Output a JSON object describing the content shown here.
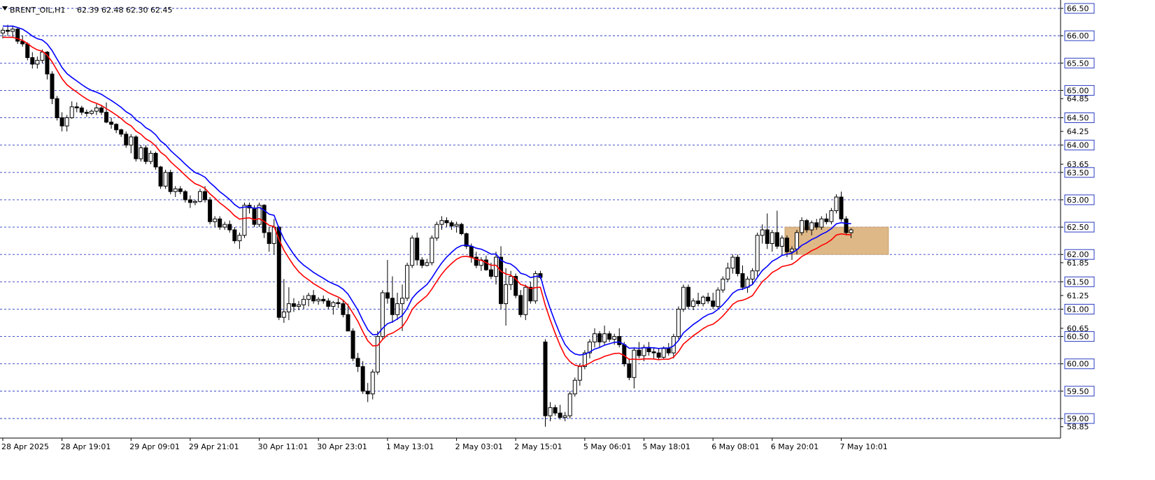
{
  "header": {
    "symbol": "BRENT_OIL,H1",
    "ohlc": "62.39 62.48 62.30 62.45"
  },
  "colors": {
    "grid": "#2a3cc2",
    "ma_fast": "#0000ff",
    "ma_slow": "#ff0000",
    "zone": "#deb887",
    "candle": "#000000",
    "background": "#ffffff"
  },
  "chart_data": {
    "type": "candlestick",
    "symbol": "BRENT_OIL",
    "timeframe": "H1",
    "ylim": [
      58.7,
      66.6
    ],
    "grid": true,
    "y_levels": [
      {
        "value": 66.5,
        "label": "66.50",
        "badge": true
      },
      {
        "value": 66.0,
        "label": "66.00",
        "badge": true
      },
      {
        "value": 65.5,
        "label": "65.50",
        "badge": true
      },
      {
        "value": 65.0,
        "label": "65.00",
        "badge": true
      },
      {
        "value": 64.85,
        "label": "64.85",
        "badge": false
      },
      {
        "value": 64.5,
        "label": "64.50",
        "badge": true
      },
      {
        "value": 64.25,
        "label": "64.25",
        "badge": false
      },
      {
        "value": 64.0,
        "label": "64.00",
        "badge": true
      },
      {
        "value": 63.65,
        "label": "63.65",
        "badge": false
      },
      {
        "value": 63.5,
        "label": "63.50",
        "badge": true
      },
      {
        "value": 63.0,
        "label": "63.00",
        "badge": true
      },
      {
        "value": 62.5,
        "label": "62.50",
        "badge": true
      },
      {
        "value": 62.0,
        "label": "62.00",
        "badge": true
      },
      {
        "value": 61.85,
        "label": "61.85",
        "badge": false
      },
      {
        "value": 61.5,
        "label": "61.50",
        "badge": true
      },
      {
        "value": 61.25,
        "label": "61.25",
        "badge": false
      },
      {
        "value": 61.0,
        "label": "61.00",
        "badge": true
      },
      {
        "value": 60.65,
        "label": "60.65",
        "badge": false
      },
      {
        "value": 60.5,
        "label": "60.50",
        "badge": true
      },
      {
        "value": 60.0,
        "label": "60.00",
        "badge": true
      },
      {
        "value": 59.5,
        "label": "59.50",
        "badge": true
      },
      {
        "value": 59.0,
        "label": "59.00",
        "badge": true
      },
      {
        "value": 58.85,
        "label": "58.85",
        "badge": false
      }
    ],
    "x_labels": [
      {
        "bar": 0,
        "label": "28 Apr 2025"
      },
      {
        "bar": 12,
        "label": "28 Apr 19:01"
      },
      {
        "bar": 26,
        "label": "29 Apr 09:01"
      },
      {
        "bar": 38,
        "label": "29 Apr 21:01"
      },
      {
        "bar": 52,
        "label": "30 Apr 11:01"
      },
      {
        "bar": 64,
        "label": "30 Apr 23:01"
      },
      {
        "bar": 78,
        "label": "1 May 13:01"
      },
      {
        "bar": 92,
        "label": "2 May 03:01"
      },
      {
        "bar": 104,
        "label": "2 May 15:01"
      },
      {
        "bar": 118,
        "label": "5 May 06:01"
      },
      {
        "bar": 130,
        "label": "5 May 18:01"
      },
      {
        "bar": 144,
        "label": "6 May 08:01"
      },
      {
        "bar": 156,
        "label": "6 May 20:01"
      },
      {
        "bar": 170,
        "label": "7 May 10:01"
      }
    ],
    "supply_zone": {
      "y_low": 62.0,
      "y_high": 62.5,
      "start_bar": 159
    },
    "ohlc": [
      [
        66.05,
        66.15,
        65.95,
        66.1
      ],
      [
        66.1,
        66.2,
        66.0,
        66.08
      ],
      [
        66.08,
        66.18,
        65.98,
        66.12
      ],
      [
        66.12,
        66.15,
        65.85,
        65.9
      ],
      [
        65.9,
        66.0,
        65.8,
        65.85
      ],
      [
        65.85,
        65.88,
        65.55,
        65.6
      ],
      [
        65.6,
        65.7,
        65.4,
        65.48
      ],
      [
        65.48,
        65.62,
        65.4,
        65.55
      ],
      [
        65.55,
        65.75,
        65.5,
        65.7
      ],
      [
        65.7,
        65.72,
        65.2,
        65.3
      ],
      [
        65.3,
        65.35,
        64.75,
        64.85
      ],
      [
        64.85,
        64.9,
        64.45,
        64.5
      ],
      [
        64.5,
        64.6,
        64.25,
        64.35
      ],
      [
        64.35,
        64.55,
        64.25,
        64.5
      ],
      [
        64.5,
        64.8,
        64.48,
        64.7
      ],
      [
        64.7,
        64.78,
        64.6,
        64.68
      ],
      [
        64.68,
        64.72,
        64.55,
        64.6
      ],
      [
        64.6,
        64.65,
        64.52,
        64.58
      ],
      [
        64.58,
        64.65,
        64.55,
        64.62
      ],
      [
        64.62,
        64.75,
        64.55,
        64.68
      ],
      [
        64.68,
        64.72,
        64.55,
        64.6
      ],
      [
        64.6,
        64.78,
        64.4,
        64.42
      ],
      [
        64.42,
        64.5,
        64.3,
        64.38
      ],
      [
        64.38,
        64.4,
        64.22,
        64.28
      ],
      [
        64.28,
        64.3,
        64.15,
        64.2
      ],
      [
        64.2,
        64.25,
        63.95,
        64.0
      ],
      [
        64.0,
        64.2,
        63.85,
        64.15
      ],
      [
        64.15,
        64.18,
        63.7,
        63.75
      ],
      [
        63.75,
        64.0,
        63.7,
        63.95
      ],
      [
        63.95,
        64.0,
        63.65,
        63.7
      ],
      [
        63.7,
        63.9,
        63.65,
        63.85
      ],
      [
        63.85,
        63.88,
        63.55,
        63.6
      ],
      [
        63.6,
        63.62,
        63.2,
        63.25
      ],
      [
        63.25,
        63.55,
        63.2,
        63.5
      ],
      [
        63.5,
        63.55,
        63.1,
        63.15
      ],
      [
        63.15,
        63.25,
        63.05,
        63.2
      ],
      [
        63.2,
        63.25,
        63.1,
        63.15
      ],
      [
        63.15,
        63.18,
        62.95,
        63.0
      ],
      [
        63.0,
        63.08,
        62.85,
        62.95
      ],
      [
        62.95,
        63.0,
        62.9,
        62.97
      ],
      [
        62.97,
        63.2,
        62.95,
        63.15
      ],
      [
        63.15,
        63.25,
        62.95,
        63.0
      ],
      [
        63.0,
        63.05,
        62.55,
        62.6
      ],
      [
        62.6,
        62.7,
        62.5,
        62.65
      ],
      [
        62.65,
        62.7,
        62.45,
        62.5
      ],
      [
        62.5,
        62.6,
        62.45,
        62.55
      ],
      [
        62.55,
        62.62,
        62.4,
        62.45
      ],
      [
        62.45,
        62.5,
        62.2,
        62.25
      ],
      [
        62.25,
        62.4,
        62.1,
        62.35
      ],
      [
        62.35,
        62.95,
        62.3,
        62.9
      ],
      [
        62.9,
        62.95,
        62.75,
        62.85
      ],
      [
        62.85,
        62.9,
        62.5,
        62.55
      ],
      [
        62.55,
        62.95,
        62.5,
        62.9
      ],
      [
        62.9,
        62.92,
        62.3,
        62.4
      ],
      [
        62.4,
        62.5,
        62.05,
        62.2
      ],
      [
        62.2,
        62.65,
        62.0,
        62.5
      ],
      [
        62.5,
        62.52,
        60.8,
        60.85
      ],
      [
        60.85,
        61.55,
        60.75,
        60.95
      ],
      [
        60.95,
        61.4,
        60.8,
        61.1
      ],
      [
        61.1,
        61.2,
        60.95,
        61.05
      ],
      [
        61.05,
        61.15,
        60.98,
        61.08
      ],
      [
        61.08,
        61.25,
        61.0,
        61.18
      ],
      [
        61.18,
        61.3,
        61.05,
        61.25
      ],
      [
        61.25,
        61.35,
        61.1,
        61.15
      ],
      [
        61.15,
        61.22,
        61.08,
        61.18
      ],
      [
        61.18,
        61.25,
        61.1,
        61.15
      ],
      [
        61.15,
        61.2,
        61.0,
        61.05
      ],
      [
        61.05,
        61.15,
        60.9,
        61.12
      ],
      [
        61.12,
        61.2,
        61.02,
        61.1
      ],
      [
        61.1,
        61.15,
        60.85,
        60.9
      ],
      [
        60.9,
        61.1,
        60.6,
        60.6
      ],
      [
        60.6,
        60.65,
        60.05,
        60.1
      ],
      [
        60.1,
        60.2,
        59.85,
        59.95
      ],
      [
        59.95,
        60.05,
        59.45,
        59.5
      ],
      [
        59.5,
        59.65,
        59.3,
        59.45
      ],
      [
        59.45,
        59.9,
        59.35,
        59.85
      ],
      [
        59.85,
        60.6,
        59.8,
        60.5
      ],
      [
        60.5,
        61.35,
        60.45,
        61.3
      ],
      [
        61.3,
        61.9,
        61.1,
        61.2
      ],
      [
        61.2,
        61.6,
        60.75,
        60.9
      ],
      [
        60.9,
        61.3,
        60.8,
        61.1
      ],
      [
        61.1,
        61.45,
        60.6,
        61.2
      ],
      [
        61.2,
        61.85,
        61.15,
        61.8
      ],
      [
        61.8,
        62.35,
        61.75,
        62.3
      ],
      [
        62.3,
        62.4,
        61.8,
        61.9
      ],
      [
        61.9,
        61.95,
        61.75,
        61.8
      ],
      [
        61.8,
        61.92,
        61.78,
        61.85
      ],
      [
        61.85,
        62.35,
        61.8,
        62.3
      ],
      [
        62.3,
        62.6,
        62.25,
        62.55
      ],
      [
        62.55,
        62.7,
        62.45,
        62.62
      ],
      [
        62.62,
        62.68,
        62.5,
        62.58
      ],
      [
        62.58,
        62.62,
        62.45,
        62.52
      ],
      [
        62.52,
        62.6,
        62.4,
        62.55
      ],
      [
        62.55,
        62.58,
        62.35,
        62.38
      ],
      [
        62.38,
        62.4,
        62.1,
        62.15
      ],
      [
        62.15,
        62.2,
        61.85,
        61.95
      ],
      [
        61.95,
        62.05,
        61.75,
        61.8
      ],
      [
        61.8,
        61.95,
        61.7,
        61.9
      ],
      [
        61.9,
        61.98,
        61.7,
        61.72
      ],
      [
        61.72,
        61.85,
        61.55,
        61.6
      ],
      [
        61.6,
        62.05,
        61.45,
        61.95
      ],
      [
        61.95,
        62.15,
        61.0,
        61.1
      ],
      [
        61.1,
        61.75,
        60.7,
        61.45
      ],
      [
        61.45,
        61.7,
        61.35,
        61.6
      ],
      [
        61.6,
        61.65,
        61.2,
        61.25
      ],
      [
        61.25,
        61.35,
        60.85,
        60.9
      ],
      [
        60.9,
        61.45,
        60.8,
        61.4
      ],
      [
        61.4,
        61.5,
        61.1,
        61.15
      ],
      [
        61.15,
        61.7,
        61.1,
        61.65
      ],
      [
        61.65,
        61.7,
        61.55,
        61.58
      ],
      [
        60.4,
        60.45,
        58.85,
        59.05
      ],
      [
        59.05,
        59.3,
        58.95,
        59.2
      ],
      [
        59.2,
        59.25,
        59.05,
        59.1
      ],
      [
        59.1,
        59.25,
        58.98,
        59.02
      ],
      [
        59.02,
        59.12,
        58.95,
        59.05
      ],
      [
        59.05,
        59.5,
        59.0,
        59.45
      ],
      [
        59.45,
        59.75,
        59.4,
        59.7
      ],
      [
        59.7,
        60.0,
        59.6,
        59.95
      ],
      [
        59.95,
        60.25,
        59.9,
        60.2
      ],
      [
        60.2,
        60.45,
        60.1,
        60.4
      ],
      [
        60.4,
        60.65,
        60.3,
        60.55
      ],
      [
        60.55,
        60.6,
        60.3,
        60.4
      ],
      [
        60.4,
        60.7,
        60.35,
        60.55
      ],
      [
        60.55,
        60.6,
        60.4,
        60.45
      ],
      [
        60.45,
        60.55,
        60.35,
        60.5
      ],
      [
        60.5,
        60.65,
        60.3,
        60.35
      ],
      [
        60.35,
        60.4,
        59.95,
        60.0
      ],
      [
        60.0,
        60.1,
        59.7,
        59.75
      ],
      [
        59.75,
        60.3,
        59.55,
        60.25
      ],
      [
        60.25,
        60.4,
        60.1,
        60.15
      ],
      [
        60.15,
        60.35,
        60.05,
        60.3
      ],
      [
        60.3,
        60.4,
        60.15,
        60.22
      ],
      [
        60.22,
        60.3,
        60.1,
        60.2
      ],
      [
        60.2,
        60.28,
        60.08,
        60.12
      ],
      [
        60.12,
        60.32,
        60.08,
        60.28
      ],
      [
        60.28,
        60.38,
        60.15,
        60.2
      ],
      [
        60.2,
        60.55,
        60.1,
        60.5
      ],
      [
        60.5,
        61.05,
        60.45,
        61.0
      ],
      [
        61.0,
        61.45,
        60.95,
        61.4
      ],
      [
        61.4,
        61.45,
        61.0,
        61.05
      ],
      [
        61.05,
        61.2,
        60.98,
        61.15
      ],
      [
        61.15,
        61.3,
        61.05,
        61.1
      ],
      [
        61.1,
        61.25,
        61.05,
        61.22
      ],
      [
        61.22,
        61.3,
        61.1,
        61.15
      ],
      [
        61.15,
        61.3,
        61.0,
        61.05
      ],
      [
        61.05,
        61.4,
        61.0,
        61.35
      ],
      [
        61.35,
        61.6,
        61.3,
        61.55
      ],
      [
        61.55,
        61.85,
        61.5,
        61.75
      ],
      [
        61.75,
        62.0,
        61.65,
        61.95
      ],
      [
        61.95,
        62.0,
        61.6,
        61.65
      ],
      [
        61.65,
        61.8,
        61.35,
        61.4
      ],
      [
        61.4,
        61.6,
        61.3,
        61.55
      ],
      [
        61.55,
        61.75,
        61.45,
        61.7
      ],
      [
        61.7,
        62.4,
        61.6,
        62.35
      ],
      [
        62.35,
        62.55,
        62.2,
        62.45
      ],
      [
        62.45,
        62.75,
        62.1,
        62.2
      ],
      [
        62.2,
        62.45,
        62.05,
        62.4
      ],
      [
        62.4,
        62.8,
        62.1,
        62.15
      ],
      [
        62.15,
        62.35,
        62.0,
        62.3
      ],
      [
        62.3,
        62.35,
        61.95,
        62.05
      ],
      [
        62.05,
        62.15,
        61.9,
        62.1
      ],
      [
        62.1,
        62.45,
        62.0,
        62.4
      ],
      [
        62.4,
        62.68,
        62.35,
        62.62
      ],
      [
        62.62,
        62.65,
        62.4,
        62.45
      ],
      [
        62.45,
        62.62,
        62.35,
        62.58
      ],
      [
        62.58,
        62.65,
        62.45,
        62.5
      ],
      [
        62.5,
        62.7,
        62.45,
        62.65
      ],
      [
        62.65,
        62.75,
        62.55,
        62.6
      ],
      [
        62.6,
        62.85,
        62.55,
        62.8
      ],
      [
        62.8,
        63.1,
        62.75,
        63.05
      ],
      [
        63.05,
        63.15,
        62.6,
        62.65
      ],
      [
        62.65,
        62.7,
        62.35,
        62.4
      ],
      [
        62.4,
        62.48,
        62.3,
        62.45
      ]
    ]
  }
}
